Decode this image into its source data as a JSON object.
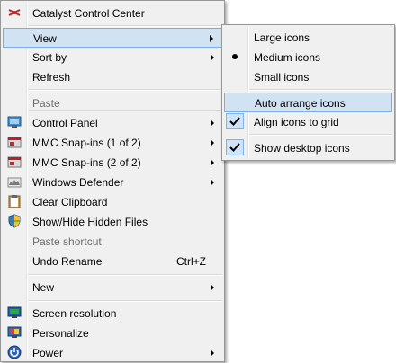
{
  "main_menu": {
    "items": [
      {
        "label": "Catalyst Control Center",
        "icon": "catalyst-icon"
      },
      {
        "label": "View",
        "submenu": true
      },
      {
        "label": "Sort by",
        "submenu": true
      },
      {
        "label": "Refresh"
      },
      {
        "label": "Paste",
        "disabled": true
      },
      {
        "label": "Control Panel",
        "icon": "control-panel-icon",
        "submenu": true
      },
      {
        "label": "MMC Snap-ins (1 of 2)",
        "icon": "mmc-icon",
        "submenu": true
      },
      {
        "label": "MMC Snap-ins (2 of 2)",
        "icon": "mmc-icon",
        "submenu": true
      },
      {
        "label": "Windows Defender",
        "icon": "windows-defender-icon",
        "submenu": true
      },
      {
        "label": "Clear Clipboard",
        "icon": "clipboard-icon"
      },
      {
        "label": "Show/Hide Hidden Files",
        "icon": "shield-icon"
      },
      {
        "label": "Paste shortcut",
        "disabled": true
      },
      {
        "label": "Undo Rename",
        "shortcut": "Ctrl+Z"
      },
      {
        "label": "New",
        "submenu": true
      },
      {
        "label": "Screen resolution",
        "icon": "screen-resolution-icon"
      },
      {
        "label": "Personalize",
        "icon": "personalize-icon"
      },
      {
        "label": "Power",
        "icon": "power-icon",
        "submenu": true
      }
    ]
  },
  "view_submenu": {
    "items": [
      {
        "label": "Large icons"
      },
      {
        "label": "Medium icons",
        "selected": true
      },
      {
        "label": "Small icons"
      },
      {
        "label": "Auto arrange icons"
      },
      {
        "label": "Align icons to grid",
        "checked": true
      },
      {
        "label": "Show desktop icons",
        "checked": true
      }
    ]
  },
  "colors": {
    "menu_background": "#f0f0f0",
    "highlight_fill": "#d1e2f2",
    "highlight_border": "#78aee5",
    "disabled_text": "#6d6d6d"
  }
}
